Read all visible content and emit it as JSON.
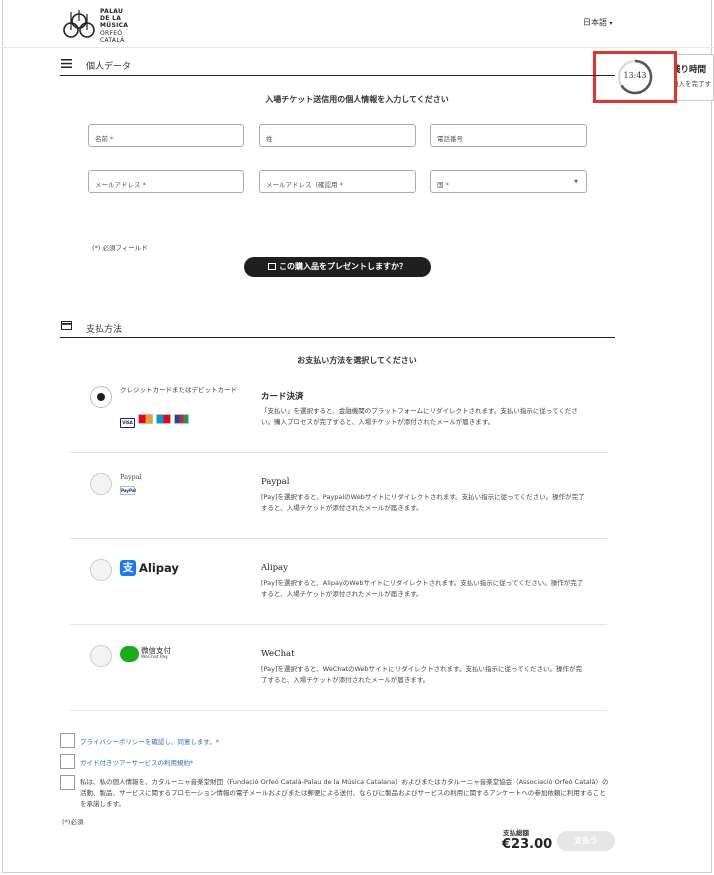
{
  "header": {
    "logo_lines": [
      "PALAU",
      "DE LA",
      "MÚSICA",
      "ORFEÓ",
      "CATALÀ"
    ],
    "language": "日本語",
    "language_caret": "▾"
  },
  "timer": {
    "time": "13:43",
    "title": "残り時間",
    "subtitle": "購入を完了す"
  },
  "personal": {
    "section_title": "個人データ",
    "heading": "入場チケット送信用の個人情報を入力してください",
    "fields": {
      "name": "名前 *",
      "surname": "姓",
      "phone": "電話番号",
      "email": "メールアドレス *",
      "email_confirm": "メールアドレス（確認用 *",
      "country": "国 *"
    },
    "required_note": "(*) 必須フィールド",
    "gift_button": "この購入品をプレゼントしますか？"
  },
  "payment": {
    "section_title": "支払方法",
    "heading": "お支払い方法を選択してください",
    "methods": [
      {
        "label": "クレジットカードまたはデビットカード",
        "title": "カード決済",
        "desc": "「支払い」を選択すると、金融機関のプラットフォームにリダイレクトされます。支払い指示に従ってください。購入プロセスが完了すると、入場チケットが添付されたメールが届きます。",
        "selected": true
      },
      {
        "label": "Paypal",
        "logo": "PayPal",
        "title": "Paypal",
        "desc": "[Pay]を選択すると、PaypalのWebサイトにリダイレクトされます。支払い指示に従ってください。操作が完了すると、入場チケットが添付されたメールが届きます。",
        "selected": false
      },
      {
        "logo": "Alipay",
        "title": "Alipay",
        "desc": "[Pay]を選択すると、AlipayのWebサイトにリダイレクトされます。支払い指示に従ってください。操作が完了すると、入場チケットが添付されたメールが届きます。",
        "selected": false
      },
      {
        "logo": "微信支付",
        "logo_sub": "WeChat Pay",
        "title": "WeChat",
        "desc": "[Pay]を選択すると、WeChatのWebサイトにリダイレクトされます。支払い指示に従ってください。操作が完了すると、入場チケットが添付されたメールが届きます。",
        "selected": false
      }
    ]
  },
  "consent": {
    "privacy": "プライバシーポリシーを確認し、同意します。*",
    "guide_terms": "ガイド付きツアーサービスの利用規約*",
    "marketing": "私は、私の個人情報を、カタルーニャ音楽堂財団（Fundació Orfeó Català-Palau de la Música Catalana）およびまたはカタルーニャ音楽堂協会（Associació Orfeó Català）の活動、製品、サービスに関するプロモーション情報の電子メールおよびまたは郵便による送付、ならびに製品およびサービスの利用に関するアンケートへの参加依頼に利用することを承諾します。",
    "required": "(*)必須"
  },
  "total": {
    "label": "支払総額",
    "amount": "€23.00",
    "pay_button": "支払う"
  },
  "colors": {
    "timer_highlight": "#e8302c",
    "button_dark": "#1f1f1f",
    "link_blue": "#3568b8"
  }
}
